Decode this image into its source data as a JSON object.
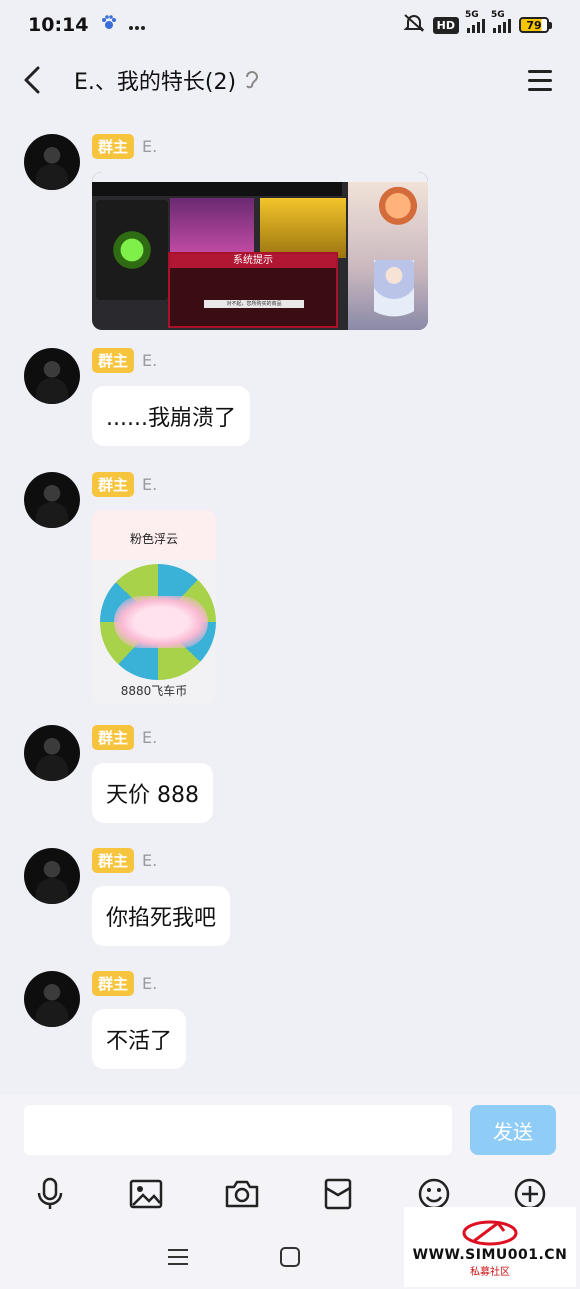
{
  "status_bar": {
    "time": "10:14",
    "hd": "HD",
    "net1": "5G",
    "net2": "5G",
    "battery": "79"
  },
  "header": {
    "title": "E.、我的特长(2)"
  },
  "messages": [
    {
      "role": "群主",
      "sender": "E.",
      "kind": "image",
      "image": {
        "dialog_title": "系统提示",
        "dialog_text": "对不起，您所购买的商品"
      }
    },
    {
      "role": "群主",
      "sender": "E.",
      "kind": "text",
      "text": "......我崩溃了"
    },
    {
      "role": "群主",
      "sender": "E.",
      "kind": "sticker",
      "sticker": {
        "label": "粉色浮云",
        "price": "8880飞车币"
      }
    },
    {
      "role": "群主",
      "sender": "E.",
      "kind": "text",
      "text": "天价 888"
    },
    {
      "role": "群主",
      "sender": "E.",
      "kind": "text",
      "text": "你掐死我吧"
    },
    {
      "role": "群主",
      "sender": "E.",
      "kind": "text",
      "text": "不活了"
    }
  ],
  "composer": {
    "send_label": "发送",
    "input_value": ""
  },
  "toolbar": {
    "icons": [
      "microphone-icon",
      "image-icon",
      "camera-icon",
      "red-packet-icon",
      "emoji-icon",
      "plus-icon"
    ]
  },
  "watermark": {
    "site": "WWW.SIMU001.CN",
    "sub": "私募社区"
  }
}
